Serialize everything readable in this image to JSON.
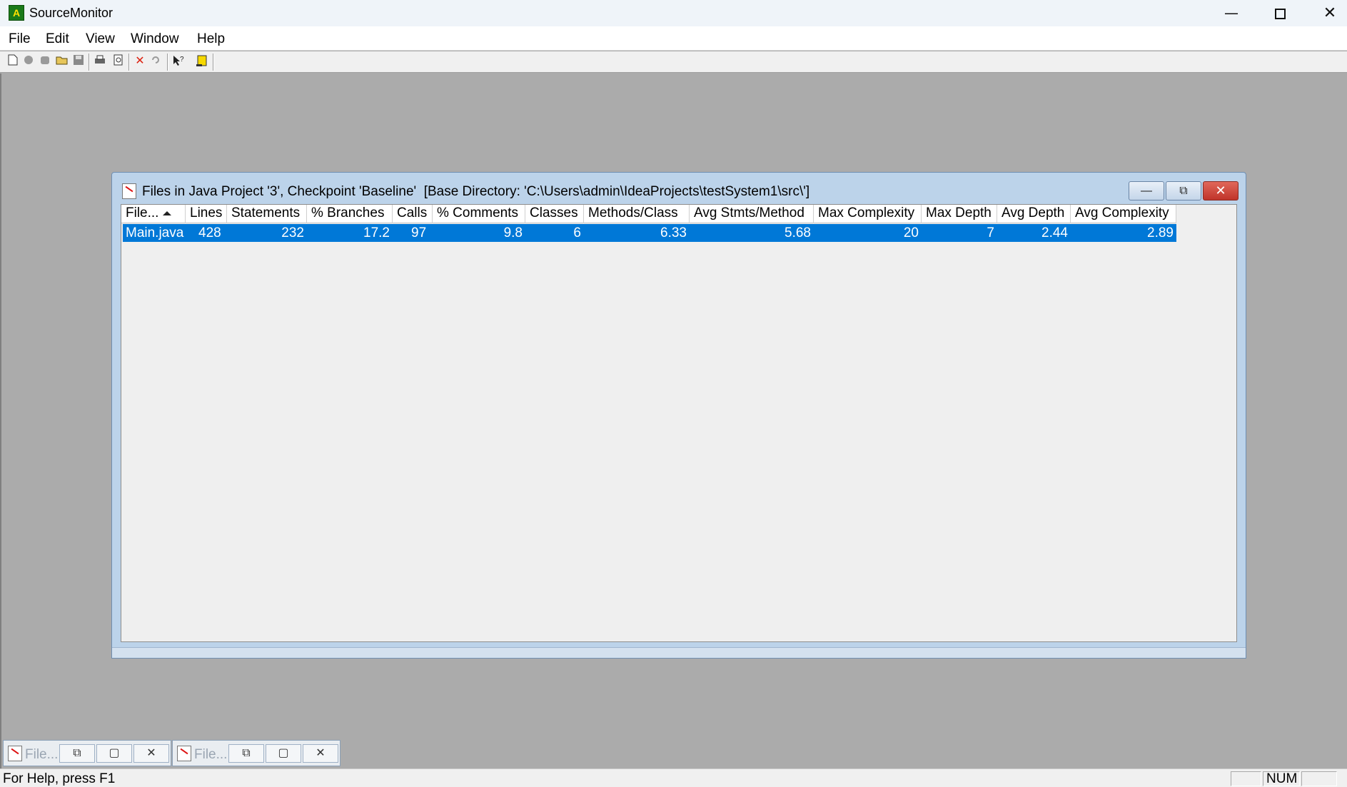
{
  "app": {
    "title": "SourceMonitor",
    "icon": "sourcemonitor-app-icon"
  },
  "window_controls": {
    "minimize": "—",
    "close": "✕"
  },
  "menu": [
    "File",
    "Edit",
    "View",
    "Window",
    "Help"
  ],
  "toolbar": {
    "buttons": [
      "new-file-icon",
      "gray-icon",
      "gray-icon",
      "open-folder-icon",
      "save-icon",
      "print-icon",
      "print-preview-icon",
      "delete-icon",
      "undo-icon",
      "context-help-icon",
      "info-icon"
    ],
    "delete_glyph": "✕"
  },
  "child_window": {
    "title": "Files in Java Project '3', Checkpoint 'Baseline'  [Base Directory: 'C:\\Users\\admin\\IdeaProjects\\testSystem1\\src\\']",
    "buttons": {
      "minimize": "—",
      "restore": "⧉",
      "close": "✕"
    },
    "columns": [
      "File...",
      "Lines",
      "Statements",
      "% Branches",
      "Calls",
      "% Comments",
      "Classes",
      "Methods/Class",
      "Avg Stmts/Method",
      "Max Complexity",
      "Max Depth",
      "Avg Depth",
      "Avg Complexity"
    ],
    "sorted_column": "File...",
    "rows": [
      [
        "Main.java",
        "428",
        "232",
        "17.2",
        "97",
        "9.8",
        "6",
        "6.33",
        "5.68",
        "20",
        "7",
        "2.44",
        "2.89"
      ]
    ]
  },
  "minimized_windows": [
    {
      "label": "File...",
      "buttons": [
        "⧉",
        "▢",
        "✕"
      ]
    },
    {
      "label": "File...",
      "buttons": [
        "⧉",
        "▢",
        "✕"
      ]
    }
  ],
  "statusbar": {
    "text": "For Help, press F1",
    "num": "NUM"
  },
  "colors": {
    "selection": "#0078d7",
    "mdi_background": "#ababab",
    "child_frame": "#bcd3ea",
    "close_button": "#c0342a"
  }
}
